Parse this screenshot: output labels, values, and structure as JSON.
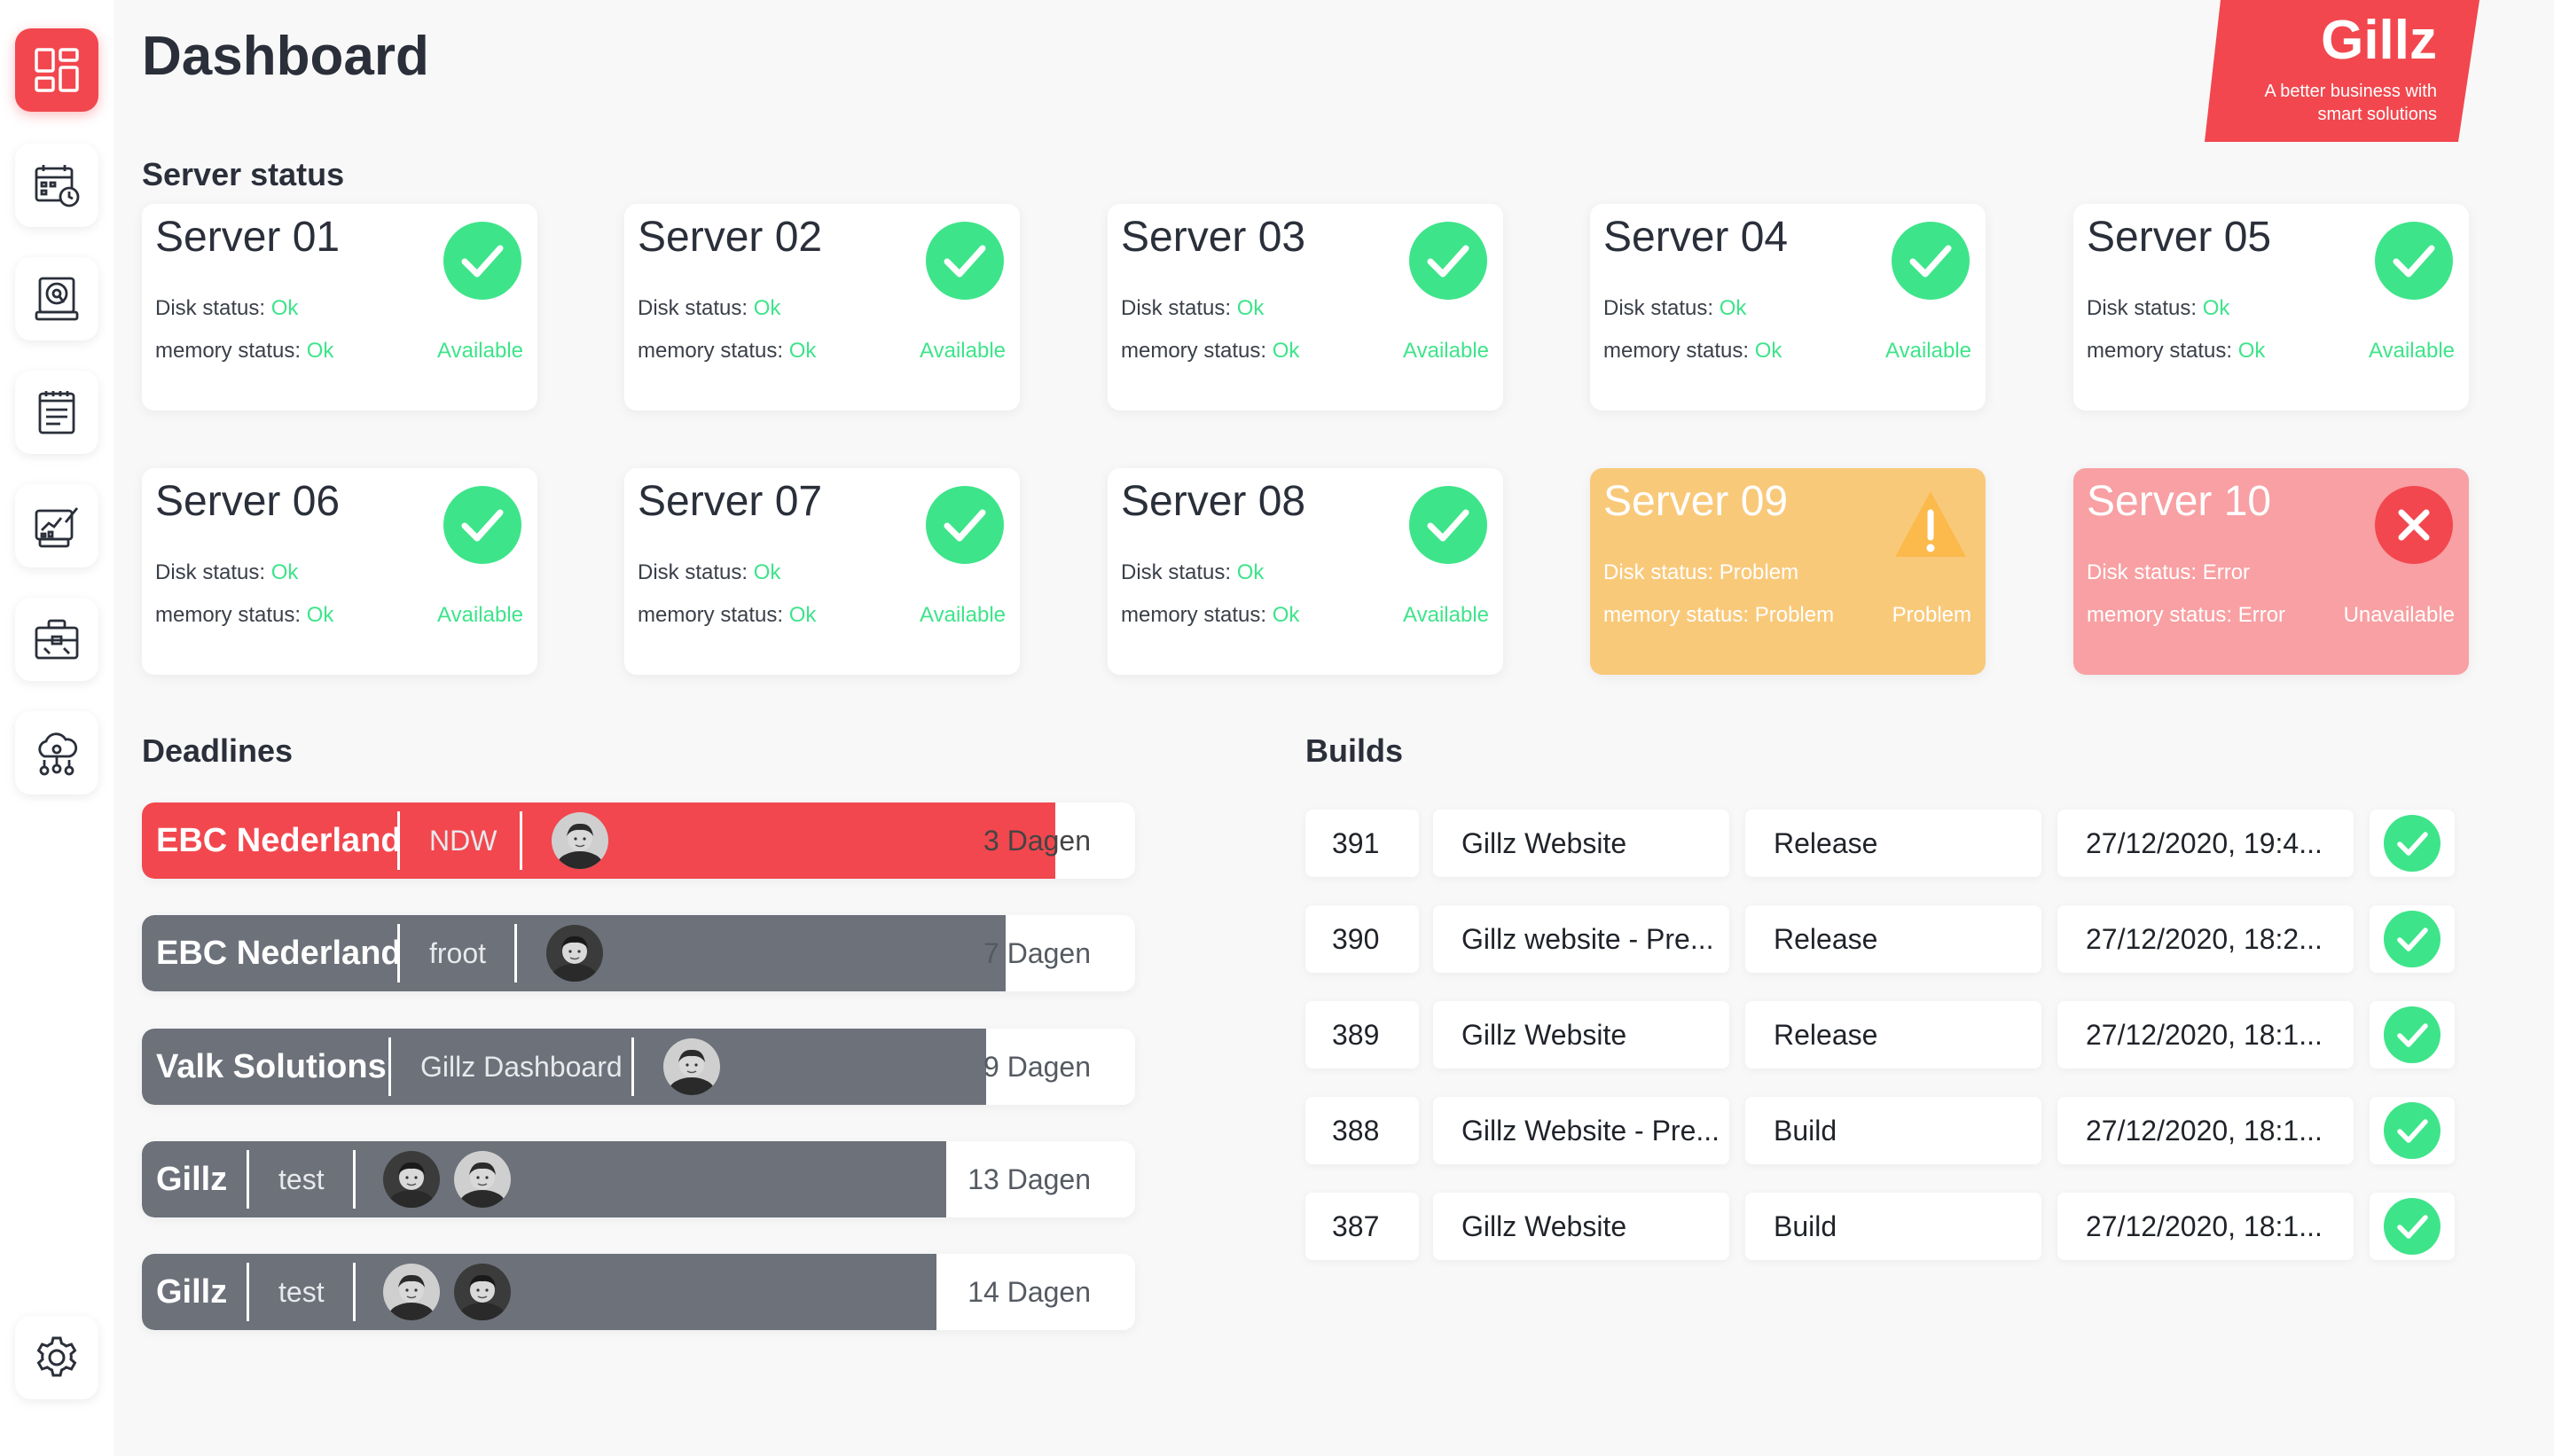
{
  "page": {
    "title": "Dashboard"
  },
  "brand": {
    "name": "Gillz",
    "tagline": "A better business with smart solutions",
    "color": "#f2474e"
  },
  "sidebar": {
    "items": [
      {
        "name": "dashboard",
        "icon": "dashboard-icon",
        "active": true
      },
      {
        "name": "calendar",
        "icon": "calendar-clock-icon",
        "active": false
      },
      {
        "name": "server",
        "icon": "disk-drive-icon",
        "active": false
      },
      {
        "name": "notes",
        "icon": "notepad-icon",
        "active": false
      },
      {
        "name": "reports",
        "icon": "chart-edit-icon",
        "active": false
      },
      {
        "name": "tools",
        "icon": "toolbox-icon",
        "active": false
      },
      {
        "name": "cloud",
        "icon": "cloud-network-icon",
        "active": false
      }
    ],
    "settings_icon": "gear-icon"
  },
  "server_status": {
    "title": "Server status",
    "disk_label": "Disk status:",
    "memory_label": "memory status:",
    "servers": [
      {
        "name": "Server 01",
        "disk": "Ok",
        "memory": "Ok",
        "state": "Available",
        "level": "ok"
      },
      {
        "name": "Server 02",
        "disk": "Ok",
        "memory": "Ok",
        "state": "Available",
        "level": "ok"
      },
      {
        "name": "Server 03",
        "disk": "Ok",
        "memory": "Ok",
        "state": "Available",
        "level": "ok"
      },
      {
        "name": "Server 04",
        "disk": "Ok",
        "memory": "Ok",
        "state": "Available",
        "level": "ok"
      },
      {
        "name": "Server 05",
        "disk": "Ok",
        "memory": "Ok",
        "state": "Available",
        "level": "ok"
      },
      {
        "name": "Server 06",
        "disk": "Ok",
        "memory": "Ok",
        "state": "Available",
        "level": "ok"
      },
      {
        "name": "Server 07",
        "disk": "Ok",
        "memory": "Ok",
        "state": "Available",
        "level": "ok"
      },
      {
        "name": "Server 08",
        "disk": "Ok",
        "memory": "Ok",
        "state": "Available",
        "level": "ok"
      },
      {
        "name": "Server 09",
        "disk": "Problem",
        "memory": "Problem",
        "state": "Problem",
        "level": "warn"
      },
      {
        "name": "Server 10",
        "disk": "Error",
        "memory": "Error",
        "state": "Unavailable",
        "level": "err"
      }
    ]
  },
  "deadlines": {
    "title": "Deadlines",
    "items": [
      {
        "company": "EBC Nederland",
        "project": "NDW",
        "days": "3 Dagen",
        "progress": 0.92,
        "color": "red"
      },
      {
        "company": "EBC Nederland",
        "project": "froot",
        "days": "7 Dagen",
        "progress": 0.87,
        "color": "grey"
      },
      {
        "company": "Valk Solutions",
        "project": "Gillz Dashboard",
        "days": "9 Dagen",
        "progress": 0.85,
        "color": "grey"
      },
      {
        "company": "Gillz",
        "project": "test",
        "days": "13 Dagen",
        "progress": 0.81,
        "color": "grey"
      },
      {
        "company": "Gillz",
        "project": "test",
        "days": "14 Dagen",
        "progress": 0.8,
        "color": "grey"
      }
    ]
  },
  "builds": {
    "title": "Builds",
    "rows": [
      {
        "number": "391",
        "name": "Gillz Website",
        "type": "Release",
        "date": "27/12/2020, 19:4...",
        "status": "success"
      },
      {
        "number": "390",
        "name": "Gillz website - Pre...",
        "type": "Release",
        "date": "27/12/2020, 18:2...",
        "status": "success"
      },
      {
        "number": "389",
        "name": "Gillz Website",
        "type": "Release",
        "date": "27/12/2020, 18:1...",
        "status": "success"
      },
      {
        "number": "388",
        "name": "Gillz Website - Pre...",
        "type": "Build",
        "date": "27/12/2020, 18:1...",
        "status": "success"
      },
      {
        "number": "387",
        "name": "Gillz Website",
        "type": "Build",
        "date": "27/12/2020, 18:1...",
        "status": "success"
      }
    ]
  }
}
